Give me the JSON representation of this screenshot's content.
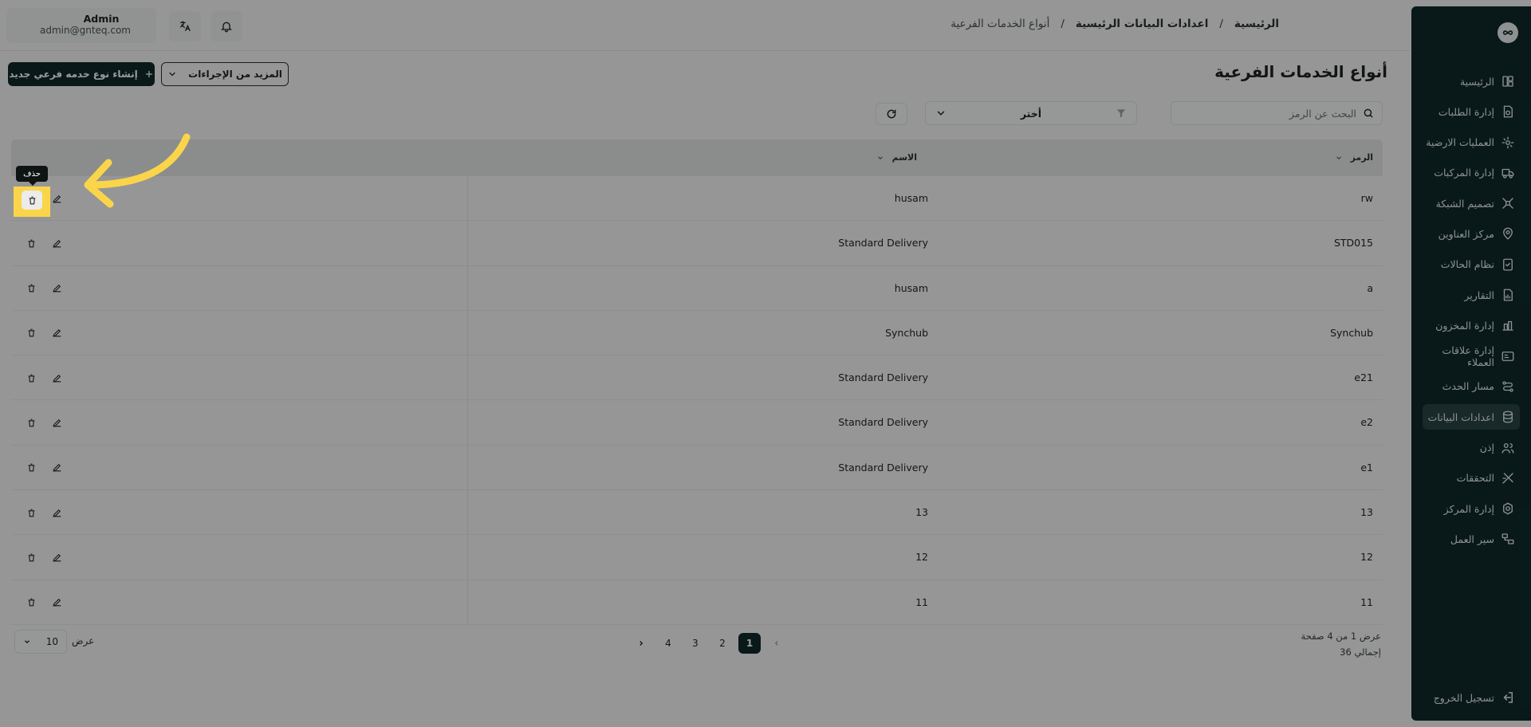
{
  "app": {
    "title": "أنواع الخدمات الفرعية",
    "user": {
      "name": "Admin",
      "email": "admin@gnteq.com"
    }
  },
  "breadcrumb": {
    "items": [
      "الرئيسية",
      "اعدادات البيانات الرئيسية",
      "أنواع الخدمات الفرعية"
    ],
    "separator": "/"
  },
  "sidebar": {
    "items": [
      {
        "label": "الرئيسية",
        "icon": "dashboard-icon"
      },
      {
        "label": "إدارة الطلبات",
        "icon": "orders-icon"
      },
      {
        "label": "العمليات الارضية",
        "icon": "ground-ops-icon"
      },
      {
        "label": "إدارة المركبات",
        "icon": "truck-icon"
      },
      {
        "label": "تصميم الشبكة",
        "icon": "network-icon"
      },
      {
        "label": "مركز العناوين",
        "icon": "address-pin-icon"
      },
      {
        "label": "نظام الحالات",
        "icon": "status-icon"
      },
      {
        "label": "التقارير",
        "icon": "reports-icon"
      },
      {
        "label": "إدارة المخزون",
        "icon": "inventory-icon"
      },
      {
        "label": "إدارة علاقات العملاء",
        "icon": "crm-icon"
      },
      {
        "label": "مسار الحدث",
        "icon": "route-icon"
      },
      {
        "label": "اعدادات البيانات",
        "icon": "database-icon",
        "active": true
      },
      {
        "label": "إذن",
        "icon": "users-icon"
      },
      {
        "label": "التحققات",
        "icon": "verify-icon"
      },
      {
        "label": "إدارة المركز",
        "icon": "center-gear-icon"
      },
      {
        "label": "سير العمل",
        "icon": "workflow-icon"
      }
    ],
    "logout_label": "تسجيل الخروج"
  },
  "toolbar": {
    "create_label": "إنشاء نوع خدمه فرعي جديد",
    "more_label": "المزيد من الإجراءات",
    "search_placeholder": "البحث عن الرمز",
    "filter_label": "أختر"
  },
  "table": {
    "columns": {
      "code": "الرمز",
      "name": "الاسم"
    },
    "rows": [
      {
        "code": "rw",
        "name": "husam"
      },
      {
        "code": "STD015",
        "name": "Standard Delivery"
      },
      {
        "code": "a",
        "name": "husam"
      },
      {
        "code": "Synchub",
        "name": "Synchub"
      },
      {
        "code": "e21",
        "name": "Standard Delivery"
      },
      {
        "code": "e2",
        "name": "Standard Delivery"
      },
      {
        "code": "e1",
        "name": "Standard Delivery"
      },
      {
        "code": "13",
        "name": "13"
      },
      {
        "code": "12",
        "name": "12"
      },
      {
        "code": "11",
        "name": "11"
      }
    ]
  },
  "pagination": {
    "pages": [
      "1",
      "2",
      "3",
      "4"
    ],
    "current": "1",
    "info": "عرض 1 من 4 صفحة",
    "total": "إجمالي 36",
    "rows_per_page": "10",
    "rows_label": "عرض"
  },
  "tooltip": {
    "delete": "حذف"
  },
  "colors": {
    "sidebar_bg": "#0f2a2a",
    "accent": "#0f2a2a",
    "highlight": "#fad54a",
    "arrow": "#fad54a"
  }
}
